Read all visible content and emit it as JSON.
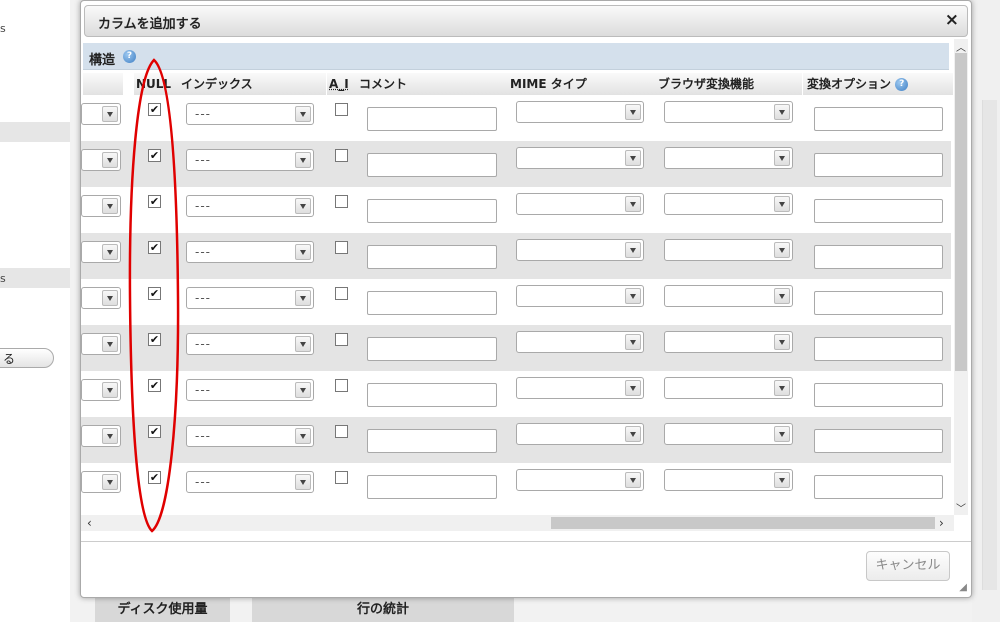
{
  "background": {
    "left_fragments": [
      {
        "text": "s"
      },
      {
        "text": "s"
      },
      {
        "text": "る"
      }
    ],
    "tabs": [
      {
        "label": "ディスク使用量"
      },
      {
        "label": "行の統計"
      }
    ]
  },
  "dialog": {
    "title": "カラムを追加する",
    "close_label": "×",
    "section_title": "構造",
    "help_glyph": "?",
    "columns": [
      {
        "label": "NULL"
      },
      {
        "label": "インデックス"
      },
      {
        "label": "A_I"
      },
      {
        "label": "コメント"
      },
      {
        "label": "MIME タイプ"
      },
      {
        "label": "ブラウザ変換機能"
      },
      {
        "label": "変換オプション"
      }
    ],
    "rows": [
      {
        "null_checked": true,
        "index_value": "---",
        "ai_checked": false,
        "comment": ""
      },
      {
        "null_checked": true,
        "index_value": "---",
        "ai_checked": false,
        "comment": ""
      },
      {
        "null_checked": true,
        "index_value": "---",
        "ai_checked": false,
        "comment": ""
      },
      {
        "null_checked": true,
        "index_value": "---",
        "ai_checked": false,
        "comment": ""
      },
      {
        "null_checked": true,
        "index_value": "---",
        "ai_checked": false,
        "comment": ""
      },
      {
        "null_checked": true,
        "index_value": "---",
        "ai_checked": false,
        "comment": ""
      },
      {
        "null_checked": true,
        "index_value": "---",
        "ai_checked": false,
        "comment": ""
      },
      {
        "null_checked": true,
        "index_value": "---",
        "ai_checked": false,
        "comment": ""
      },
      {
        "null_checked": true,
        "index_value": "---",
        "ai_checked": false,
        "comment": ""
      }
    ],
    "cancel_label": "キャンセル"
  },
  "colors": {
    "section_header": "#d4e0ec",
    "row_alt": "#e4e4e4",
    "annotation": "#e00000"
  }
}
